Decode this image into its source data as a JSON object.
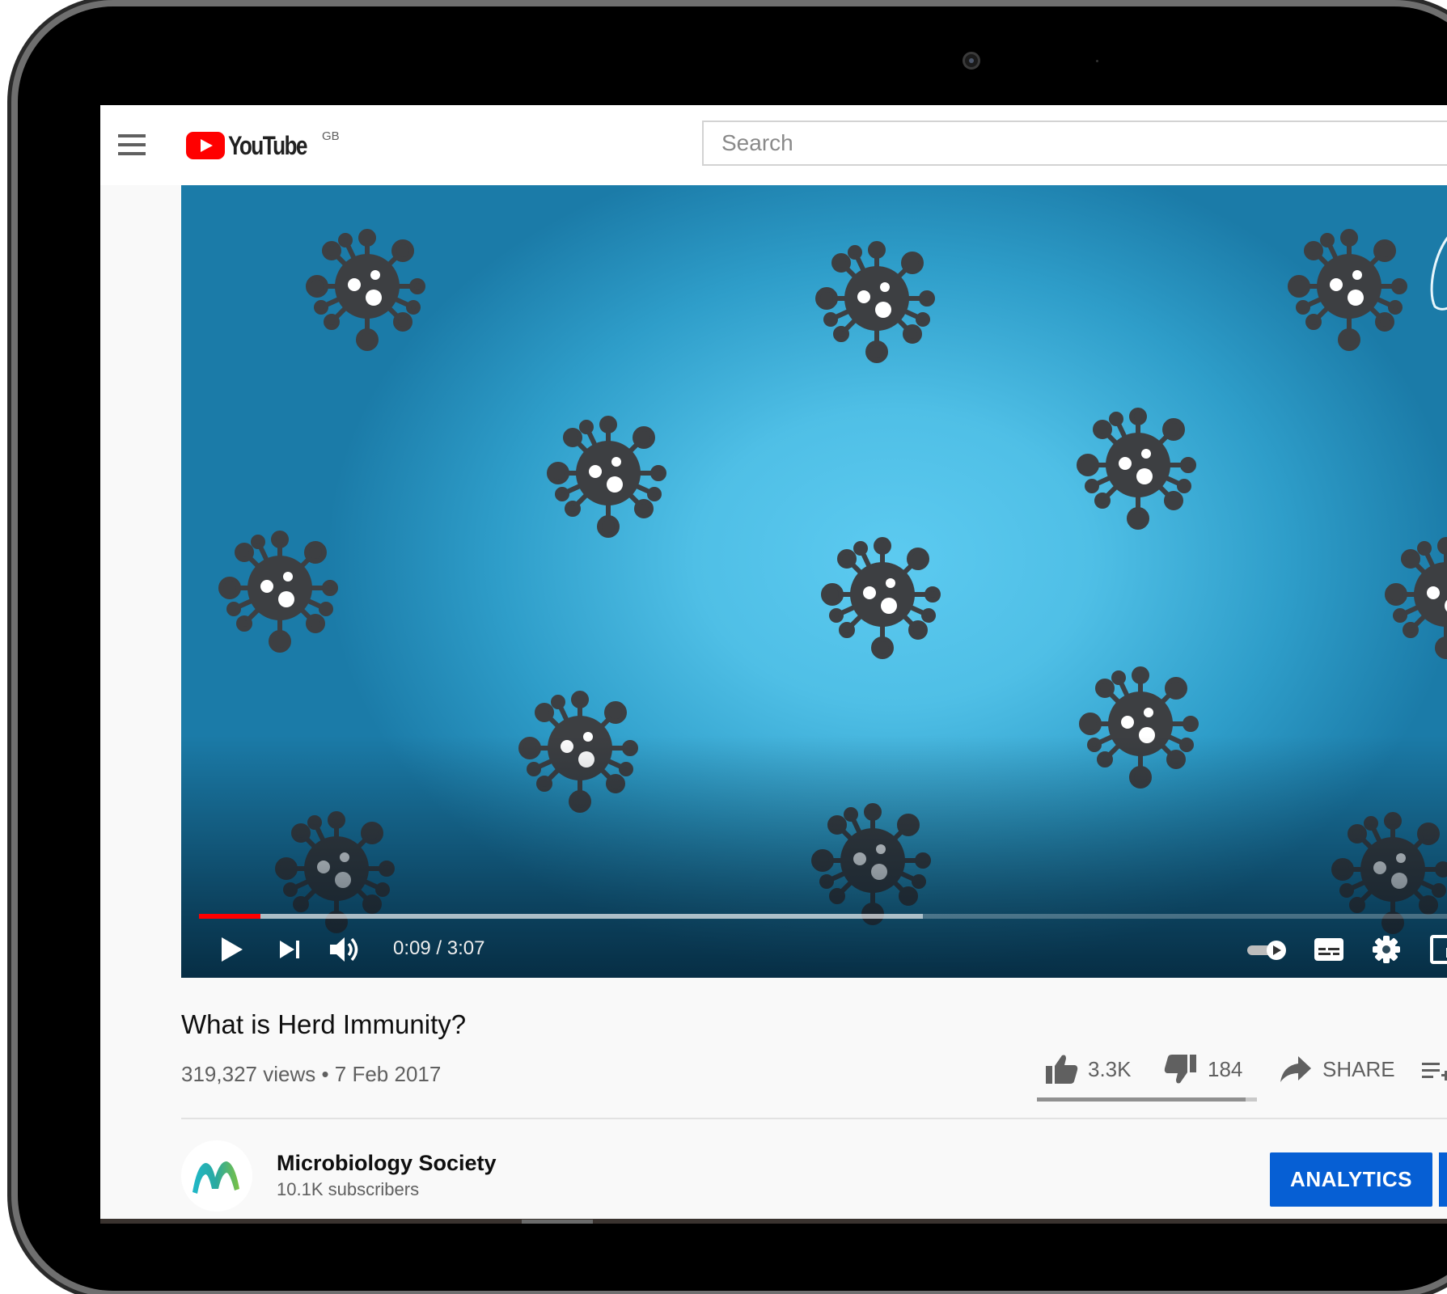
{
  "masthead": {
    "logo_text": "YouTube",
    "country_code": "GB",
    "search_placeholder": "Search"
  },
  "player": {
    "progress_played_fraction": 0.049,
    "buffered_fraction": 0.58,
    "time": "0:09 / 3:07"
  },
  "video": {
    "title": "What is Herd Immunity?",
    "meta": "319,327 views • 7 Feb 2017",
    "likes": "3.3K",
    "dislikes": "184",
    "share_label": "SHARE",
    "like_ratio": 0.947
  },
  "channel": {
    "name": "Microbiology Society",
    "subscribers": "10.1K subscribers"
  },
  "buttons": {
    "analytics": "ANALYTICS"
  },
  "colors": {
    "brand_red": "#ff0000",
    "analytics_blue": "#065fd4",
    "video_bg": "#4fbfe6",
    "virus": "#3d3f42"
  },
  "icons": [
    "menu-icon",
    "youtube-logo-icon",
    "play-icon",
    "next-icon",
    "volume-icon",
    "autoplay-toggle-icon",
    "subtitles-icon",
    "settings-gear-icon",
    "miniplayer-icon",
    "theater-mode-icon",
    "like-thumb-icon",
    "dislike-thumb-icon",
    "share-arrow-icon",
    "save-playlist-icon",
    "channel-avatar-logo"
  ]
}
